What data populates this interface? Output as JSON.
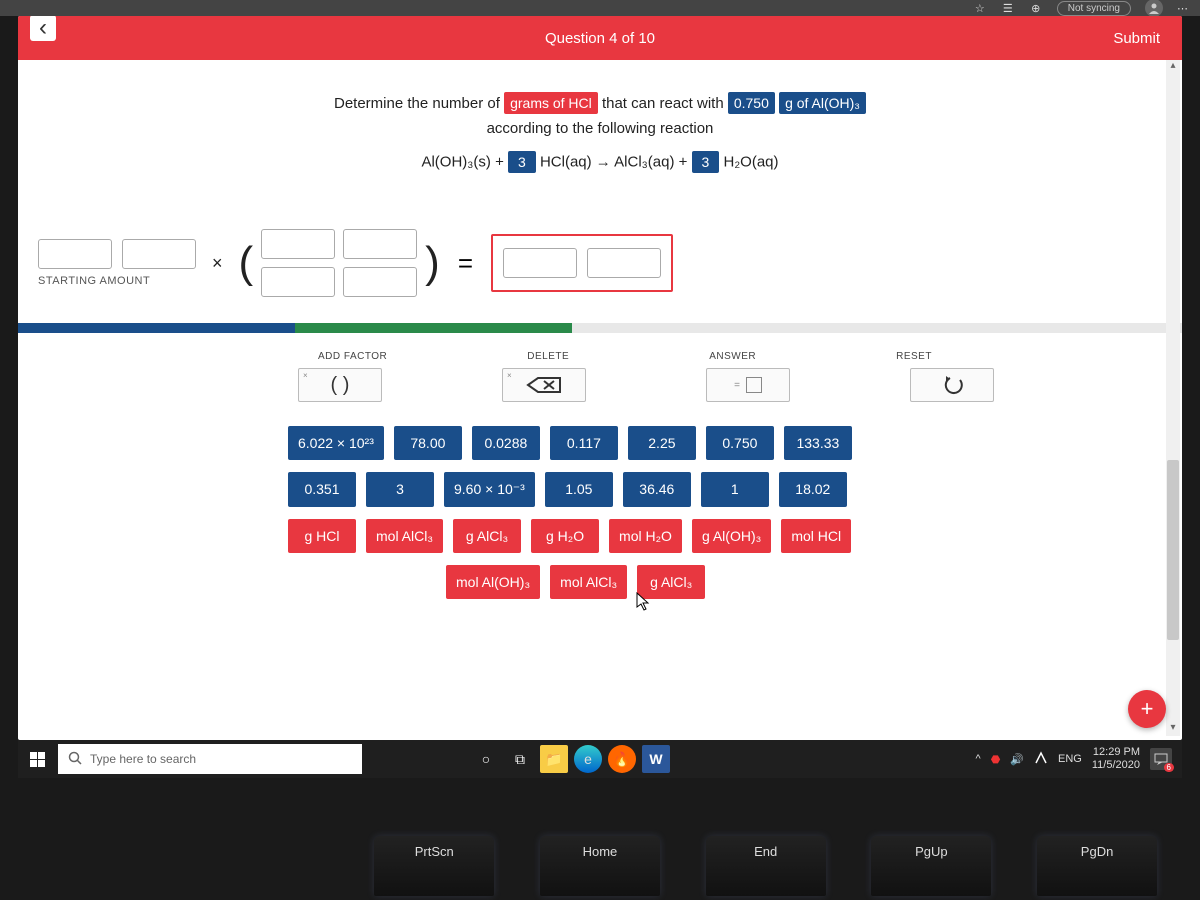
{
  "browser": {
    "sync_status": "Not syncing"
  },
  "header": {
    "title": "Question 4 of 10",
    "submit": "Submit"
  },
  "question": {
    "pre1": "Determine the number of",
    "chip1": "grams of HCl",
    "mid1": "that can react with",
    "chip2": "0.750",
    "chip3": "g of Al(OH)₃",
    "line2": "according to the following reaction",
    "eq_l": "Al(OH)₃(s) +",
    "eq_c1": "3",
    "eq_m": "HCl(aq) → AlCl₃(aq) +",
    "eq_c2": "3",
    "eq_r": "H₂O(aq)"
  },
  "workspace": {
    "starting": "STARTING AMOUNT"
  },
  "tools": {
    "t1": "ADD FACTOR",
    "t2": "DELETE",
    "t3": "ANSWER",
    "t4": "RESET",
    "paren": "(  )"
  },
  "tiles": {
    "row1": [
      "6.022 × 10²³",
      "78.00",
      "0.0288",
      "0.117",
      "2.25",
      "0.750",
      "133.33"
    ],
    "row2": [
      "0.351",
      "3",
      "9.60 × 10⁻³",
      "1.05",
      "36.46",
      "1",
      "18.02"
    ],
    "row3": [
      "g HCl",
      "mol AlCl₃",
      "g AlCl₃",
      "g H₂O",
      "mol H₂O",
      "g Al(OH)₃",
      "mol HCl"
    ],
    "row4": [
      "mol Al(OH)₃",
      "mol AlCl₃",
      "g AlCl₃"
    ]
  },
  "taskbar": {
    "search_placeholder": "Type here to search",
    "lang": "ENG",
    "time": "12:29 PM",
    "date": "11/5/2020",
    "badge": "6"
  },
  "keys": [
    "PrtScn",
    "Home",
    "End",
    "PgUp",
    "PgDn"
  ]
}
